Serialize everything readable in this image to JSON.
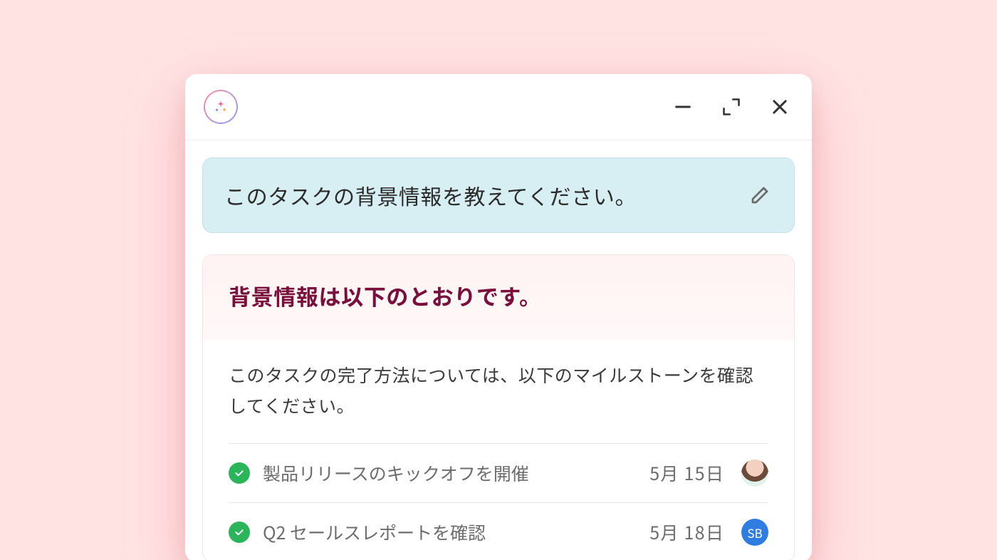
{
  "prompt": {
    "text": "このタスクの背景情報を教えてください。"
  },
  "answer": {
    "heading": "背景情報は以下のとおりです。",
    "description": "このタスクの完了方法については、以下のマイルストーンを確認してください。",
    "milestones": [
      {
        "title": "製品リリースのキックオフを開催",
        "date": "5月 15日",
        "assignee": {
          "kind": "photo",
          "initials": ""
        }
      },
      {
        "title": "Q2 セールスレポートを確認",
        "date": "5月 18日",
        "assignee": {
          "kind": "initials",
          "initials": "SB",
          "color": "blue"
        }
      }
    ]
  }
}
